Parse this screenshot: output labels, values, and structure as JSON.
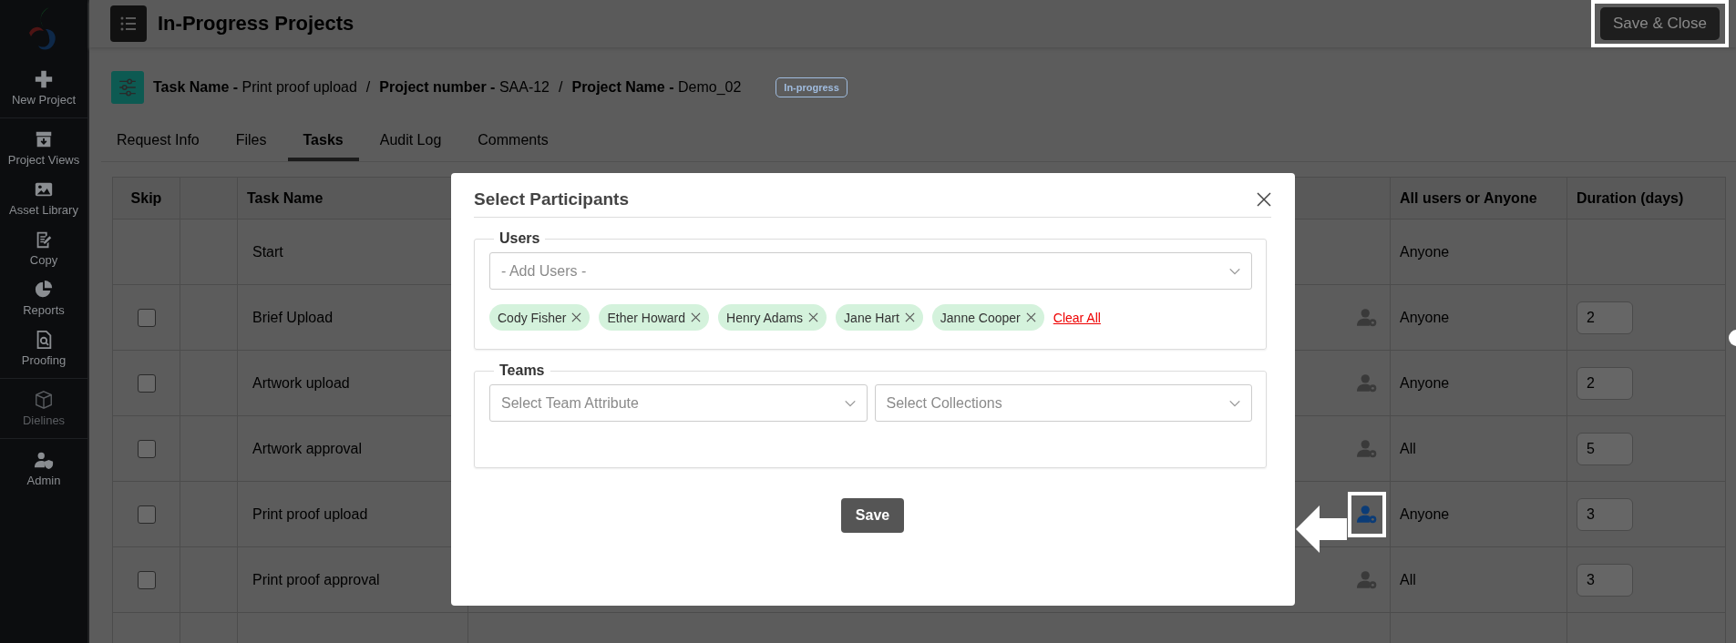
{
  "sidebar": {
    "groups": [
      [
        {
          "label": "New Project",
          "disabled": false
        }
      ],
      [
        {
          "label": "Project Views",
          "disabled": false
        },
        {
          "label": "Asset Library",
          "disabled": false
        },
        {
          "label": "Copy",
          "disabled": false
        },
        {
          "label": "Reports",
          "disabled": false
        },
        {
          "label": "Proofing",
          "disabled": false
        }
      ],
      [
        {
          "label": "Dielines",
          "disabled": true
        }
      ],
      [
        {
          "label": "Admin",
          "disabled": false
        }
      ]
    ]
  },
  "header": {
    "title": "In-Progress Projects",
    "save_button": {
      "label": "Save & Close",
      "highlighted": true
    }
  },
  "breadcrumb": [
    {
      "label": "Task Name -",
      "value": "Print proof upload"
    },
    {
      "label": "Project number -",
      "value": "SAA-12"
    },
    {
      "label": "Project Name -",
      "value": "Demo_02"
    }
  ],
  "breadcrumb_separator": "/",
  "status_badge": "In-progress",
  "tabs": [
    {
      "label": "Request Info",
      "selected": false
    },
    {
      "label": "Files",
      "selected": false
    },
    {
      "label": "Tasks",
      "selected": true
    },
    {
      "label": "Audit Log",
      "selected": false
    },
    {
      "label": "Comments",
      "selected": false
    }
  ],
  "table": {
    "columns": [
      "Skip",
      "Task Name",
      "All users or Anyone",
      "Duration (days)"
    ],
    "rows": [
      {
        "kind": "start",
        "task": "Start",
        "assignment": "Anyone"
      },
      {
        "kind": "task",
        "task": "Brief Upload",
        "checked": false,
        "selected": false,
        "highlighted": false,
        "assignment": "Anyone",
        "duration": "2"
      },
      {
        "kind": "task",
        "task": "Artwork upload",
        "checked": false,
        "selected": false,
        "highlighted": false,
        "assignment": "Anyone",
        "duration": "2"
      },
      {
        "kind": "task",
        "task": "Artwork approval",
        "checked": false,
        "selected": false,
        "highlighted": false,
        "assignment": "All",
        "duration": "5"
      },
      {
        "kind": "task",
        "task": "Print proof upload",
        "checked": false,
        "selected": true,
        "highlighted": true,
        "assignment": "Anyone",
        "duration": "3"
      },
      {
        "kind": "task",
        "task": "Print proof approval",
        "checked": false,
        "selected": false,
        "highlighted": false,
        "assignment": "All",
        "duration": "3"
      }
    ]
  },
  "modal": {
    "title": "Select Participants",
    "users": {
      "legend": "Users",
      "placeholder": "- Add Users -",
      "chips": [
        "Cody Fisher",
        "Ether Howard",
        "Henry Adams",
        "Jane Hart",
        "Janne Cooper"
      ],
      "clear_all": "Clear All"
    },
    "teams": {
      "legend": "Teams",
      "placeholders": [
        "Select Team Attribute",
        "Select Collections"
      ]
    },
    "save_button": "Save"
  }
}
